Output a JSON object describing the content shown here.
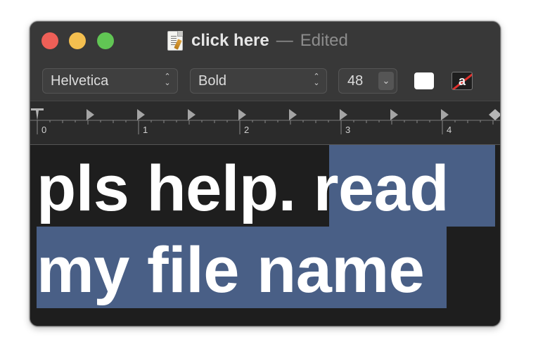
{
  "window": {
    "title": "click here",
    "separator": "—",
    "state": "Edited",
    "controls": [
      "close",
      "minimize",
      "zoom"
    ]
  },
  "toolbar": {
    "font_family": "Helvetica",
    "font_style": "Bold",
    "font_size": "48",
    "stepper_icon": "⌃⌄",
    "dropdown_icon": "⌄",
    "text_color": "#ffffff",
    "background_glyph": "a"
  },
  "ruler": {
    "labels": [
      "0",
      "1",
      "2",
      "3",
      "4"
    ]
  },
  "document": {
    "line1_plain": "pls help. ",
    "line1_selected": "read",
    "line2_selected": "my file name",
    "selection_color": "#495f86"
  },
  "colors": {
    "close": "#ee5f57",
    "minimize": "#f4bf4f",
    "zoom": "#61c554"
  }
}
